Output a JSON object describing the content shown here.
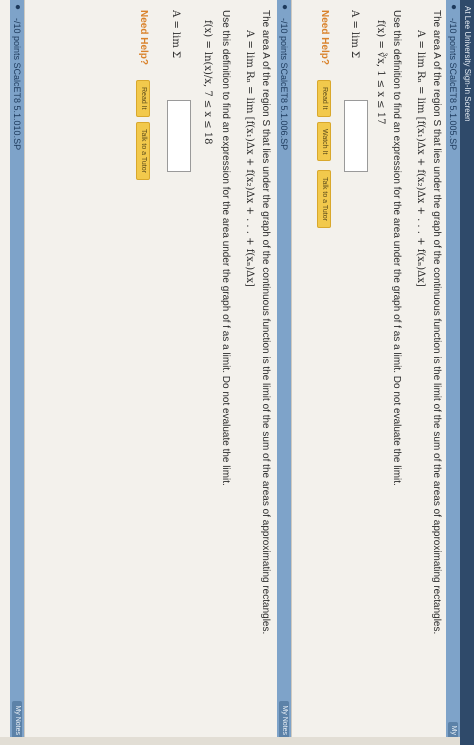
{
  "top_bar": {
    "text": "At Lee University Sign-In Screen"
  },
  "question1": {
    "header": "-/10 points SCalcET8 5.1.005.SP",
    "intro": "The area A of the region S that lies under the graph of the continuous function is the limit of the sum of the areas of approximating rectangles.",
    "formula": "A = lim Rₙ = lim [f(x₁)Δx + f(x₂)Δx + . . . + f(xₙ)Δx]",
    "instruction": "Use this definition to find an expression for the area under the graph of f as a limit. Do not evaluate the limit.",
    "function": "f(x) = ∛x, 1 ≤ x ≤ 17",
    "answer_prefix": "A = lim Σ",
    "answer_value": "",
    "need_help": "Need Help?",
    "buttons": [
      "Read It",
      "Watch It",
      "Talk to a Tutor"
    ],
    "tag": "My"
  },
  "question2": {
    "header": "-/10 points SCalcET8 5.1.006.SP",
    "intro": "The area A of the region S that lies under the graph of the continuous function is the limit of the sum of the areas of approximating rectangles.",
    "formula": "A = lim Rₙ = lim [f(x₁)Δx + f(x₂)Δx + . . . + f(xₙ)Δx]",
    "instruction": "Use this definition to find an expression for the area under the graph of f as a limit. Do not evaluate the limit.",
    "function": "f(x) = ln(x)/x, 7 ≤ x ≤ 18",
    "answer_prefix": "A = lim Σ",
    "answer_value": "",
    "need_help": "Need Help?",
    "buttons": [
      "Read It",
      "Talk to a Tutor"
    ],
    "tag": "My Notes"
  },
  "question3": {
    "header": "-/10 points SCalcET8 5.1.010.SP",
    "tag": "My Notes"
  }
}
